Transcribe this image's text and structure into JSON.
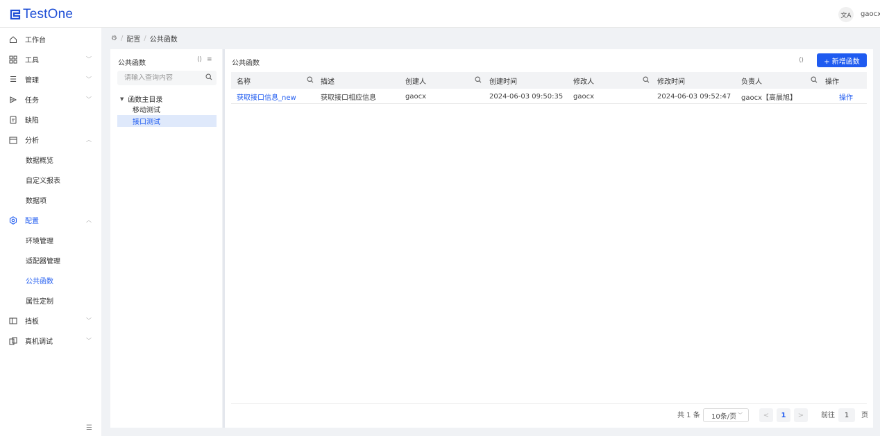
{
  "app": {
    "logo_text": "TestOne",
    "user_name": "gaocx",
    "lang_icon": "translate-icon",
    "accent_color": "#1f5bf0"
  },
  "sidebar": {
    "items": [
      {
        "label": "工作台",
        "icon": "home-icon",
        "arrow": ""
      },
      {
        "label": "工具",
        "icon": "grid-icon",
        "arrow": "down"
      },
      {
        "label": "管理",
        "icon": "list-icon",
        "arrow": "down"
      },
      {
        "label": "任务",
        "icon": "play-icon",
        "arrow": "down"
      },
      {
        "label": "缺陷",
        "icon": "doc-icon",
        "arrow": ""
      },
      {
        "label": "分析",
        "icon": "calendar-icon",
        "arrow": "up"
      },
      {
        "label": "数据概览",
        "sub": true
      },
      {
        "label": "自定义报表",
        "sub": true
      },
      {
        "label": "数据项",
        "sub": true
      },
      {
        "label": "配置",
        "icon": "gear-icon",
        "arrow": "up",
        "active": true
      },
      {
        "label": "环境管理",
        "sub": true
      },
      {
        "label": "适配器管理",
        "sub": true
      },
      {
        "label": "公共函数",
        "sub": true,
        "active": true
      },
      {
        "label": "属性定制",
        "sub": true
      },
      {
        "label": "挡板",
        "icon": "panel-icon",
        "arrow": "down"
      },
      {
        "label": "真机调试",
        "icon": "device-icon",
        "arrow": "down"
      }
    ],
    "collapse_icon": "menu-fold-icon"
  },
  "breadcrumb": {
    "items": [
      "配置",
      "公共函数"
    ]
  },
  "tree": {
    "title": "公共函数",
    "search_placeholder": "请输入查询内容",
    "root": "函数主目录",
    "nodes": [
      "移动测试",
      "接口测试"
    ],
    "selected_index": 1
  },
  "main": {
    "title": "公共函数",
    "add_button": "+ 新增函数",
    "columns": [
      "名称",
      "描述",
      "创建人",
      "创建时间",
      "修改人",
      "修改时间",
      "负责人",
      "操作"
    ],
    "rows": [
      {
        "name": "获取接口信息_new",
        "description": "获取接口相应信息",
        "creator": "gaocx",
        "created_at": "2024-06-03 09:50:35",
        "modifier": "gaocx",
        "modified_at": "2024-06-03 09:52:47",
        "owner": "gaocx【高晨旭】",
        "action": "操作"
      }
    ]
  },
  "pagination": {
    "total": "共 1 条",
    "page_size": "10条/页",
    "current_page": "1",
    "goto_label": "前往",
    "goto_value": "1",
    "page_suffix": "页"
  }
}
